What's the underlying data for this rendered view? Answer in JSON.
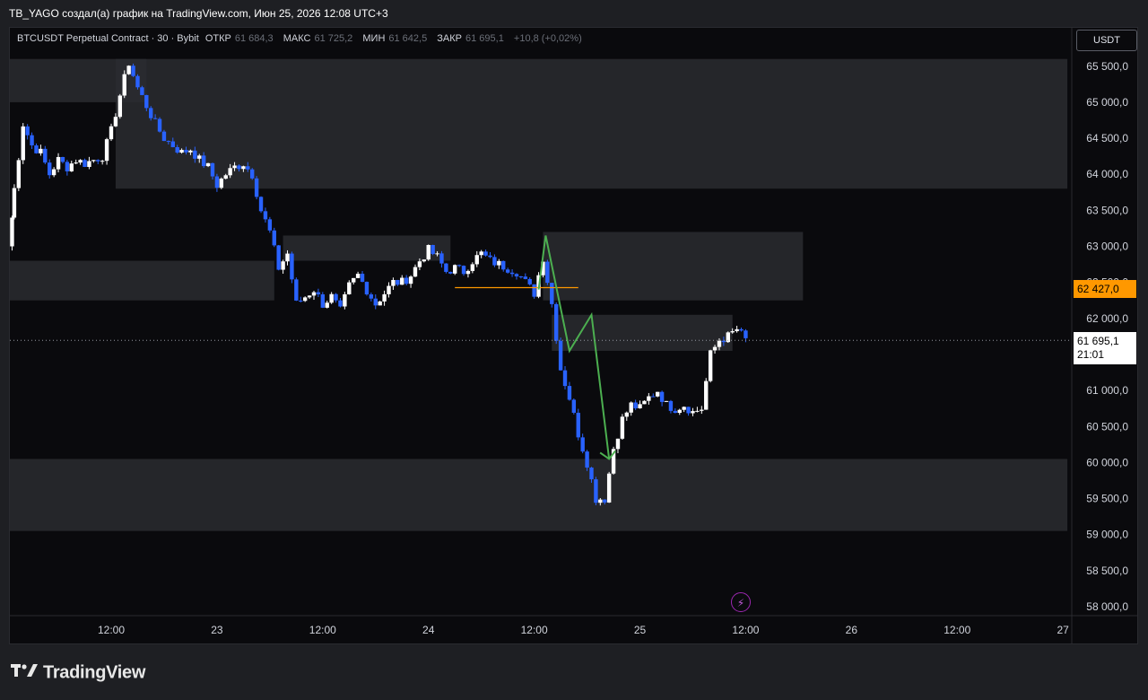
{
  "header": {
    "title": "TB_YAGO создал(а) график на TradingView.com, Июн 25, 2026 12:08 UTC+3"
  },
  "legend": {
    "symbol": "BTCUSDT Perpetual Contract · 30 · Bybit",
    "open_label": "ОТКР",
    "open_value": "61 684,3",
    "high_label": "МАКС",
    "high_value": "61 725,2",
    "low_label": "МИН",
    "low_value": "61 642,5",
    "close_label": "ЗАКР",
    "close_value": "61 695,1",
    "change": "+10,8 (+0,02%)"
  },
  "currency_button": "USDT",
  "price_tags": {
    "level": "62 427,0",
    "last_price": "61 695,1",
    "countdown": "21:01"
  },
  "branding": "TradingView",
  "colors": {
    "background": "#0a0a0d",
    "up_candle": "#ffffff",
    "down_candle": "#2962ff",
    "zone": "#2a2b30",
    "level_line": "#ff9800",
    "projection": "#4caf50"
  },
  "chart_data": {
    "type": "candlestick",
    "ylim": [
      58000,
      65800
    ],
    "y_ticks": [
      58000,
      58500,
      59000,
      59500,
      60000,
      60500,
      61000,
      61500,
      62000,
      62500,
      63000,
      63500,
      64000,
      64500,
      65000,
      65500
    ],
    "y_tick_labels": [
      "58 000,0",
      "58 500,0",
      "59 000,0",
      "59 500,0",
      "60 000,0",
      "60 500,0",
      "61 000,0",
      "61 500,0",
      "62 000,0",
      "62 500,0",
      "63 000,0",
      "63 500,0",
      "64 000,0",
      "64 500,0",
      "65 000,0",
      "65 500,0"
    ],
    "x_tick_labels": [
      "12:00",
      "23",
      "12:00",
      "24",
      "12:00",
      "25",
      "12:00",
      "26",
      "12:00",
      "27"
    ],
    "x_tick_times": [
      12,
      24,
      36,
      48,
      60,
      72,
      84,
      96,
      108,
      120
    ],
    "x_range_hours": [
      0.5,
      121
    ],
    "last_price": 61695.1,
    "level_line": {
      "price": 62427,
      "t_start": 51,
      "t_end": 65
    },
    "zones": [
      {
        "t_start": 0.5,
        "t_end": 16,
        "y_low": 65000,
        "y_high": 65600
      },
      {
        "t_start": 12.5,
        "t_end": 120.5,
        "y_low": 63800,
        "y_high": 65600
      },
      {
        "t_start": 0.5,
        "t_end": 30.5,
        "y_low": 62250,
        "y_high": 62800
      },
      {
        "t_start": 31.5,
        "t_end": 50.5,
        "y_low": 62800,
        "y_high": 63150
      },
      {
        "t_start": 61,
        "t_end": 90.5,
        "y_low": 62250,
        "y_high": 63200
      },
      {
        "t_start": 62,
        "t_end": 82.5,
        "y_low": 61550,
        "y_high": 62050
      },
      {
        "t_start": 0.5,
        "t_end": 120.5,
        "y_low": 59050,
        "y_high": 60050
      }
    ],
    "projection_path": [
      [
        60.5,
        62400
      ],
      [
        61.3,
        63150
      ],
      [
        64,
        61550
      ],
      [
        66.5,
        62050
      ],
      [
        68.5,
        60050
      ]
    ],
    "projection_arrow_tip": [
      68.5,
      60050
    ],
    "anchors": [
      [
        0.5,
        63000
      ],
      [
        1,
        63800
      ],
      [
        2,
        64700
      ],
      [
        3,
        64400
      ],
      [
        4,
        64300
      ],
      [
        5,
        64000
      ],
      [
        6,
        64200
      ],
      [
        7,
        64100
      ],
      [
        8,
        64200
      ],
      [
        9,
        64150
      ],
      [
        10,
        64200
      ],
      [
        11,
        64250
      ],
      [
        12,
        64600
      ],
      [
        13,
        65100
      ],
      [
        14,
        65550
      ],
      [
        15,
        65200
      ],
      [
        16,
        64950
      ],
      [
        17,
        64700
      ],
      [
        18,
        64500
      ],
      [
        19,
        64400
      ],
      [
        20,
        64300
      ],
      [
        21,
        64350
      ],
      [
        22,
        64200
      ],
      [
        23,
        64100
      ],
      [
        24,
        63850
      ],
      [
        25,
        64000
      ],
      [
        26,
        64100
      ],
      [
        27,
        64150
      ],
      [
        28,
        64000
      ],
      [
        29,
        63500
      ],
      [
        30,
        63200
      ],
      [
        31,
        62700
      ],
      [
        32,
        62900
      ],
      [
        33,
        62200
      ],
      [
        34,
        62300
      ],
      [
        35,
        62400
      ],
      [
        36,
        62200
      ],
      [
        37,
        62300
      ],
      [
        38,
        62100
      ],
      [
        39,
        62450
      ],
      [
        40,
        62600
      ],
      [
        41,
        62400
      ],
      [
        42,
        62200
      ],
      [
        43,
        62350
      ],
      [
        44,
        62500
      ],
      [
        45,
        62500
      ],
      [
        46,
        62600
      ],
      [
        47,
        62800
      ],
      [
        48,
        62950
      ],
      [
        49,
        62850
      ],
      [
        50,
        62650
      ],
      [
        51,
        62700
      ],
      [
        52,
        62650
      ],
      [
        53,
        62800
      ],
      [
        54,
        62900
      ],
      [
        55,
        62800
      ],
      [
        56,
        62750
      ],
      [
        57,
        62700
      ],
      [
        58,
        62650
      ],
      [
        59,
        62500
      ],
      [
        60,
        62350
      ],
      [
        61,
        62850
      ],
      [
        62,
        62200
      ],
      [
        63,
        61300
      ],
      [
        64,
        60900
      ],
      [
        65,
        60400
      ],
      [
        66,
        60000
      ],
      [
        67,
        59500
      ],
      [
        68,
        59500
      ],
      [
        69,
        60200
      ],
      [
        70,
        60600
      ],
      [
        71,
        60800
      ],
      [
        72,
        60750
      ],
      [
        73,
        60900
      ],
      [
        74,
        61000
      ],
      [
        75,
        60800
      ],
      [
        76,
        60750
      ],
      [
        77,
        60800
      ],
      [
        78,
        60700
      ],
      [
        79,
        60750
      ],
      [
        80,
        61500
      ],
      [
        81,
        61700
      ],
      [
        82,
        61750
      ],
      [
        83,
        61850
      ],
      [
        84,
        61700
      ]
    ]
  }
}
